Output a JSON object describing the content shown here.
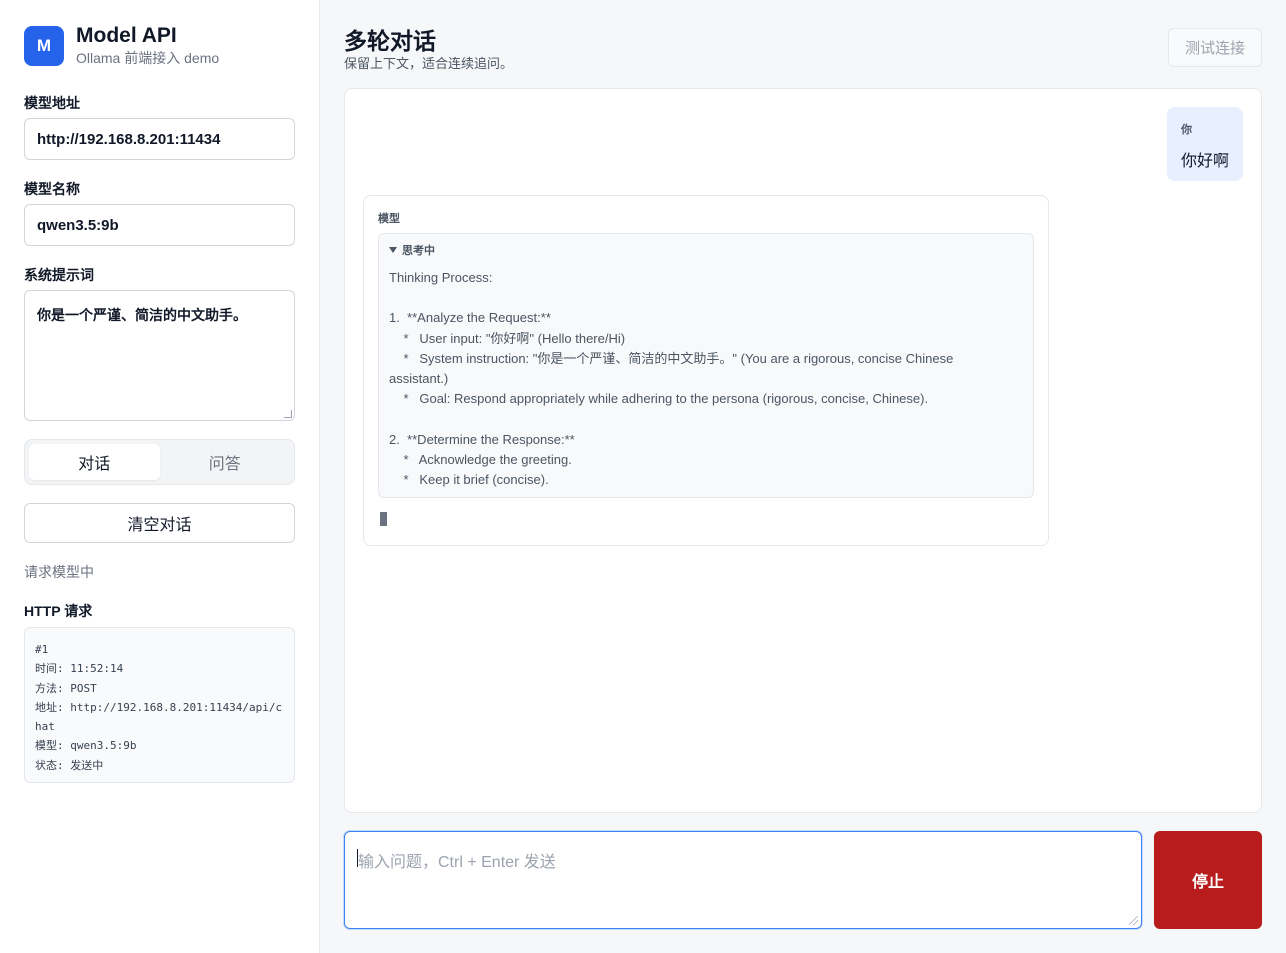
{
  "brand": {
    "logo_letter": "M",
    "title": "Model API",
    "subtitle": "Ollama 前端接入 demo"
  },
  "settings": {
    "url_label": "模型地址",
    "url_value": "http://192.168.8.201:11434",
    "model_label": "模型名称",
    "model_value": "qwen3.5:9b",
    "system_label": "系统提示词",
    "system_value": "你是一个严谨、简洁的中文助手。"
  },
  "mode_tabs": [
    {
      "label": "对话",
      "active": true
    },
    {
      "label": "问答",
      "active": false
    }
  ],
  "clear_label": "清空对话",
  "status_text": "请求模型中",
  "http": {
    "title": "HTTP 请求",
    "lines": [
      "#1",
      "时间: 11:52:14",
      "方法: POST",
      "地址: http://192.168.8.201:11434/api/c",
      "hat",
      "模型: qwen3.5:9b",
      "状态: 发送中"
    ]
  },
  "main": {
    "title": "多轮对话",
    "subtitle": "保留上下文，适合连续追问。",
    "test_label": "测试连接"
  },
  "messages": {
    "user_role": "你",
    "user_text": "你好啊",
    "model_role": "模型",
    "thinking_label": "思考中",
    "thinking_lines": [
      "Thinking Process:",
      "",
      "1.  **Analyze the Request:**",
      "    *   User input: \"你好啊\" (Hello there/Hi)",
      "    *   System instruction: \"你是一个严谨、简洁的中文助手。\" (You are a rigorous, concise Chinese",
      "assistant.)",
      "    *   Goal: Respond appropriately while adhering to the persona (rigorous, concise, Chinese).",
      "",
      "2.  **Determine the Response:**",
      "    *   Acknowledge the greeting.",
      "    *   Keep it brief (concise)."
    ]
  },
  "composer": {
    "placeholder": "输入问题，Ctrl + Enter 发送",
    "stop_label": "停止"
  }
}
